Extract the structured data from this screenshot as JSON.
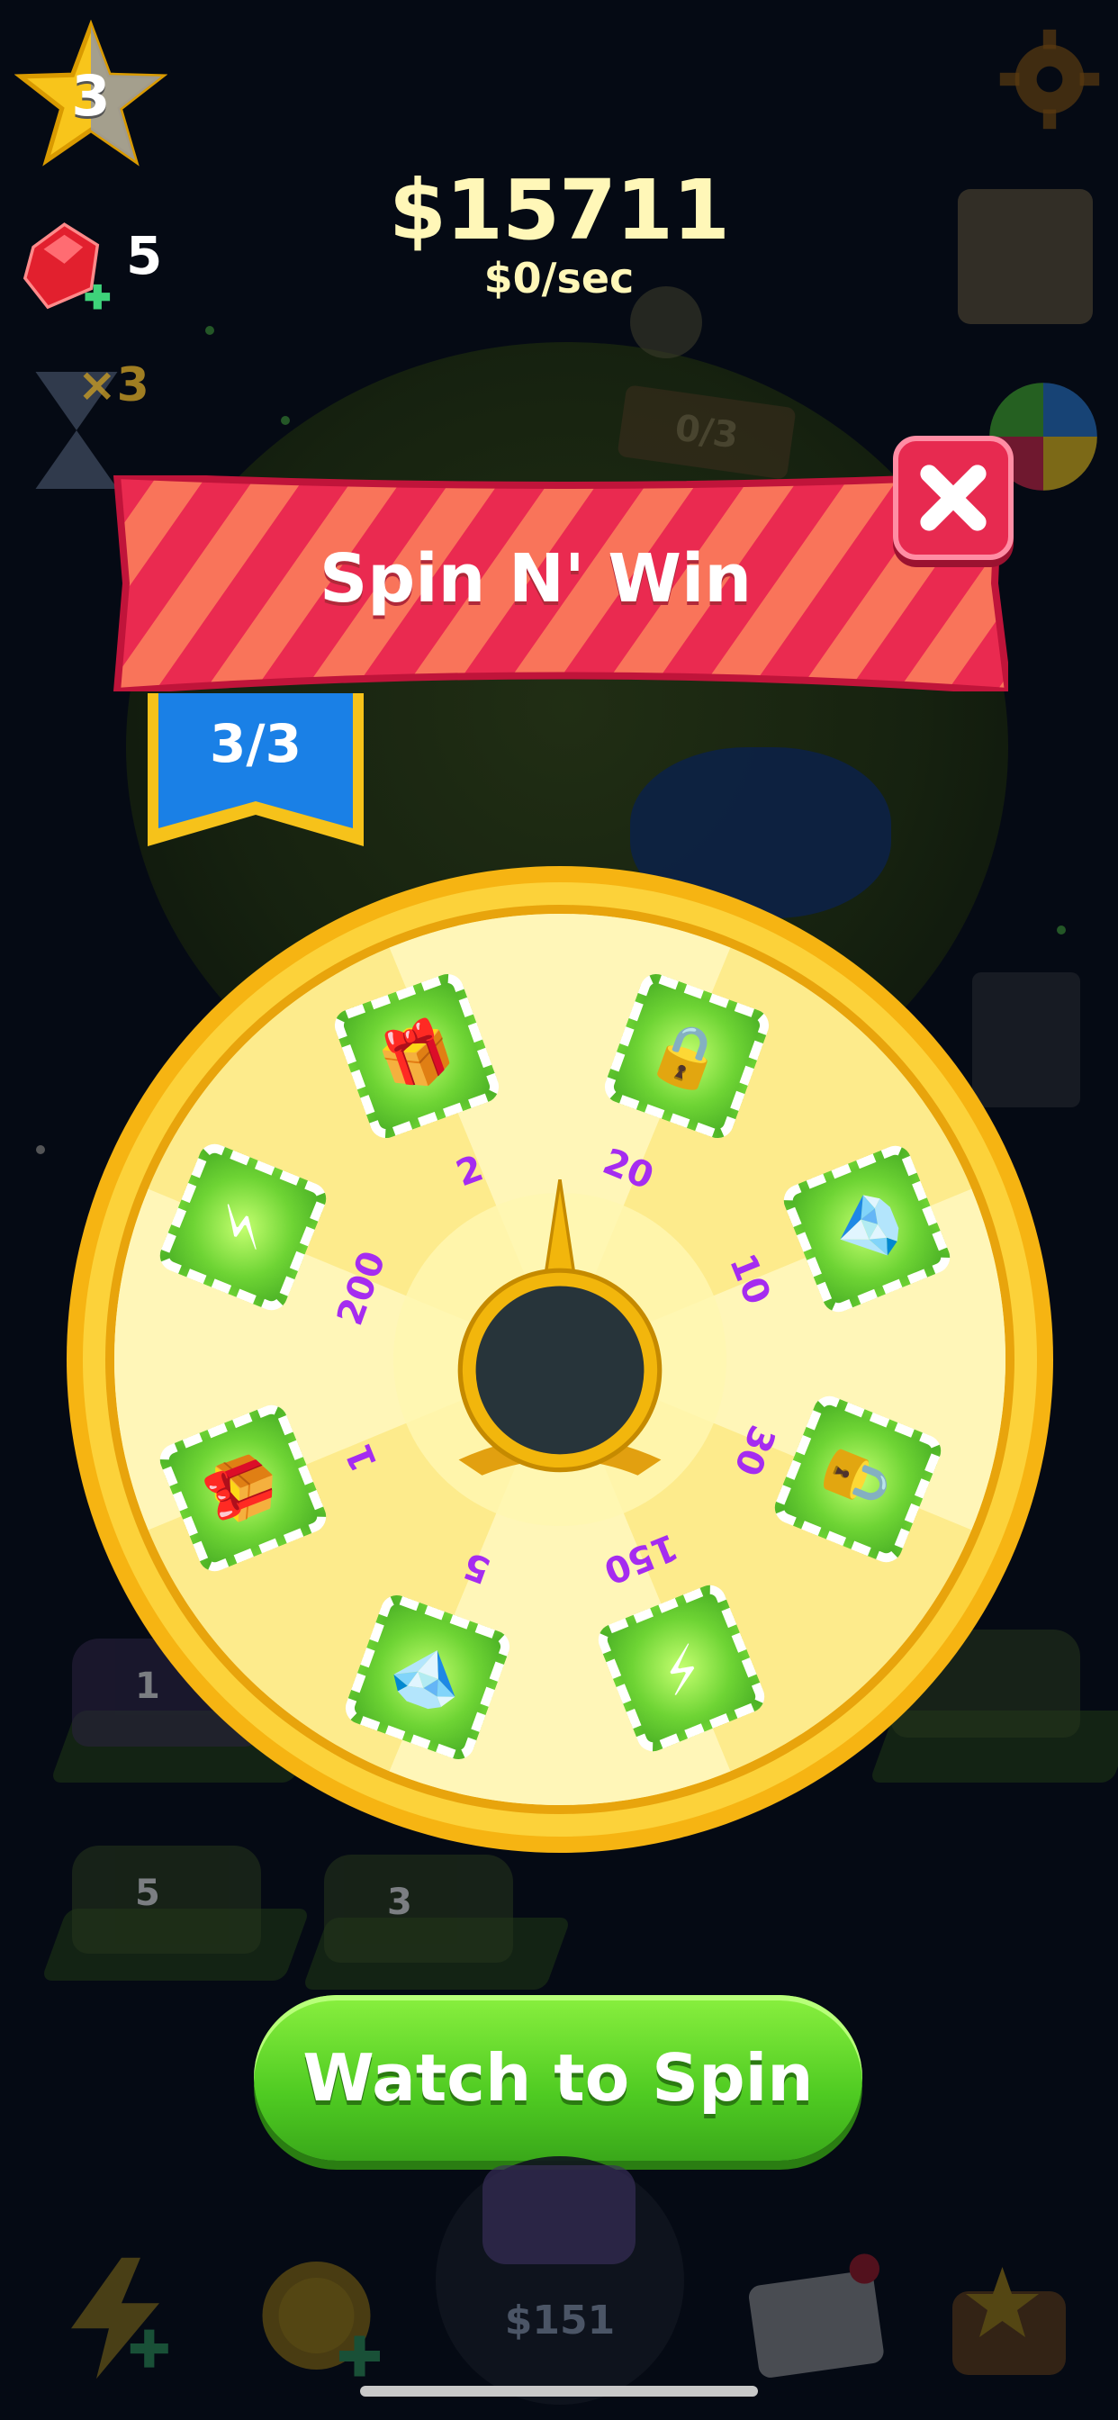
{
  "hud": {
    "level": "3",
    "money": "$15711",
    "rate": "$0/sec",
    "gems": "5",
    "booster_label": "×3",
    "quest_progress": "0/3"
  },
  "dialog": {
    "title": "Spin N' Win",
    "spins_progress": "3/3",
    "spin_button_label": "Watch to Spin"
  },
  "wheel": {
    "segments": [
      {
        "value": "2",
        "icon": "gift-icon"
      },
      {
        "value": "20",
        "icon": "safe-icon"
      },
      {
        "value": "10",
        "icon": "gem-icon"
      },
      {
        "value": "30",
        "icon": "safe-icon"
      },
      {
        "value": "150",
        "icon": "lightning-icon"
      },
      {
        "value": "5",
        "icon": "gem-icon"
      },
      {
        "value": "1",
        "icon": "gift-icon"
      },
      {
        "value": "200",
        "icon": "lightning-icon"
      }
    ]
  },
  "background": {
    "car_numbers": [
      "1",
      "5",
      "3"
    ],
    "bottom_price": "$151"
  },
  "colors": {
    "money": "#fff7b8",
    "banner_red": "#e8294a",
    "wheel_gold": "#f6c21a",
    "segment_text": "#a52cf0",
    "spin_green": "#4fcb22"
  }
}
